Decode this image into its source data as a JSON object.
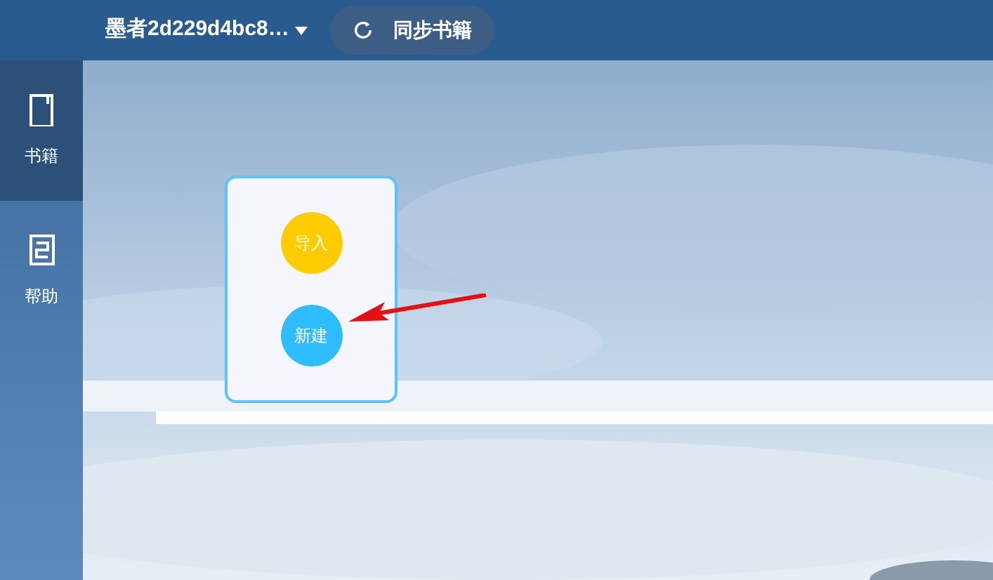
{
  "header": {
    "user": "墨者2d229d4bc8…",
    "sync_button": "同步书籍"
  },
  "sidebar": {
    "items": [
      {
        "label": "书籍",
        "kind": "book",
        "selected": true
      },
      {
        "label": "帮助",
        "kind": "help",
        "selected": false
      }
    ]
  },
  "popup": {
    "buttons": [
      {
        "label": "导入",
        "color": "#fdcb02"
      },
      {
        "label": "新建",
        "color": "#2ebcfd"
      }
    ]
  },
  "annotation": {
    "kind": "arrow"
  }
}
